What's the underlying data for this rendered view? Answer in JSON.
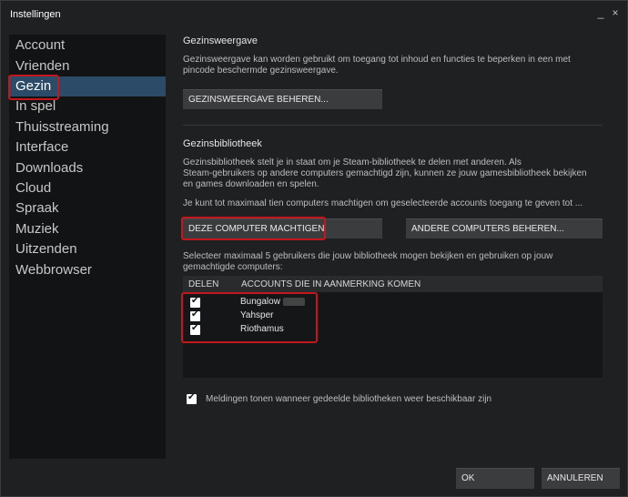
{
  "window": {
    "title": "Instellingen"
  },
  "titlebar_buttons": {
    "minimize": "_",
    "close": "×"
  },
  "sidebar": {
    "items": [
      {
        "label": "Account"
      },
      {
        "label": "Vrienden"
      },
      {
        "label": "Gezin"
      },
      {
        "label": "In spel"
      },
      {
        "label": "Thuisstreaming"
      },
      {
        "label": "Interface"
      },
      {
        "label": "Downloads"
      },
      {
        "label": "Cloud"
      },
      {
        "label": "Spraak"
      },
      {
        "label": "Muziek"
      },
      {
        "label": "Uitzenden"
      },
      {
        "label": "Webbrowser"
      }
    ],
    "active_index": 2
  },
  "family_view": {
    "title": "Gezinsweergave",
    "description_line1": "Gezinsweergave kan worden gebruikt om toegang tot inhoud en functies te beperken in een met",
    "description_line2": "pincode beschermde gezinsweergave.",
    "manage_button": "GEZINSWEERGAVE BEHEREN..."
  },
  "family_library": {
    "title": "Gezinsbibliotheek",
    "description_line1": "Gezinsbibliotheek stelt je in staat om je Steam-bibliotheek te delen met anderen. Als",
    "description_line2": "Steam-gebruikers op andere computers gemachtigd zijn, kunnen ze jouw gamesbibliotheek bekijken",
    "description_line3": "en games downloaden en spelen.",
    "limit_text": "Je kunt tot maximaal tien computers machtigen om geselecteerde accounts toegang te geven tot ...",
    "authorize_button": "DEZE COMPUTER MACHTIGEN",
    "other_computers_button": "ANDERE COMPUTERS BEHEREN...",
    "select_line1": "Selecteer maximaal 5 gebruikers die jouw bibliotheek mogen bekijken en gebruiken op jouw",
    "select_line2": "gemachtigde computers:",
    "table": {
      "col_share": "DELEN",
      "col_accounts": "ACCOUNTS DIE IN AANMERKING KOMEN",
      "rows": [
        {
          "name": "Bungalow",
          "checked": true
        },
        {
          "name": "Yahsper",
          "checked": true
        },
        {
          "name": "Riothamus",
          "checked": true
        }
      ]
    },
    "notify_label": "Meldingen tonen wanneer gedeelde bibliotheken weer beschikbaar zijn",
    "notify_checked": true
  },
  "footer": {
    "ok": "OK",
    "cancel": "ANNULEREN"
  },
  "colors": {
    "highlight": "#c4161d",
    "active_item": "#2c4b69"
  }
}
